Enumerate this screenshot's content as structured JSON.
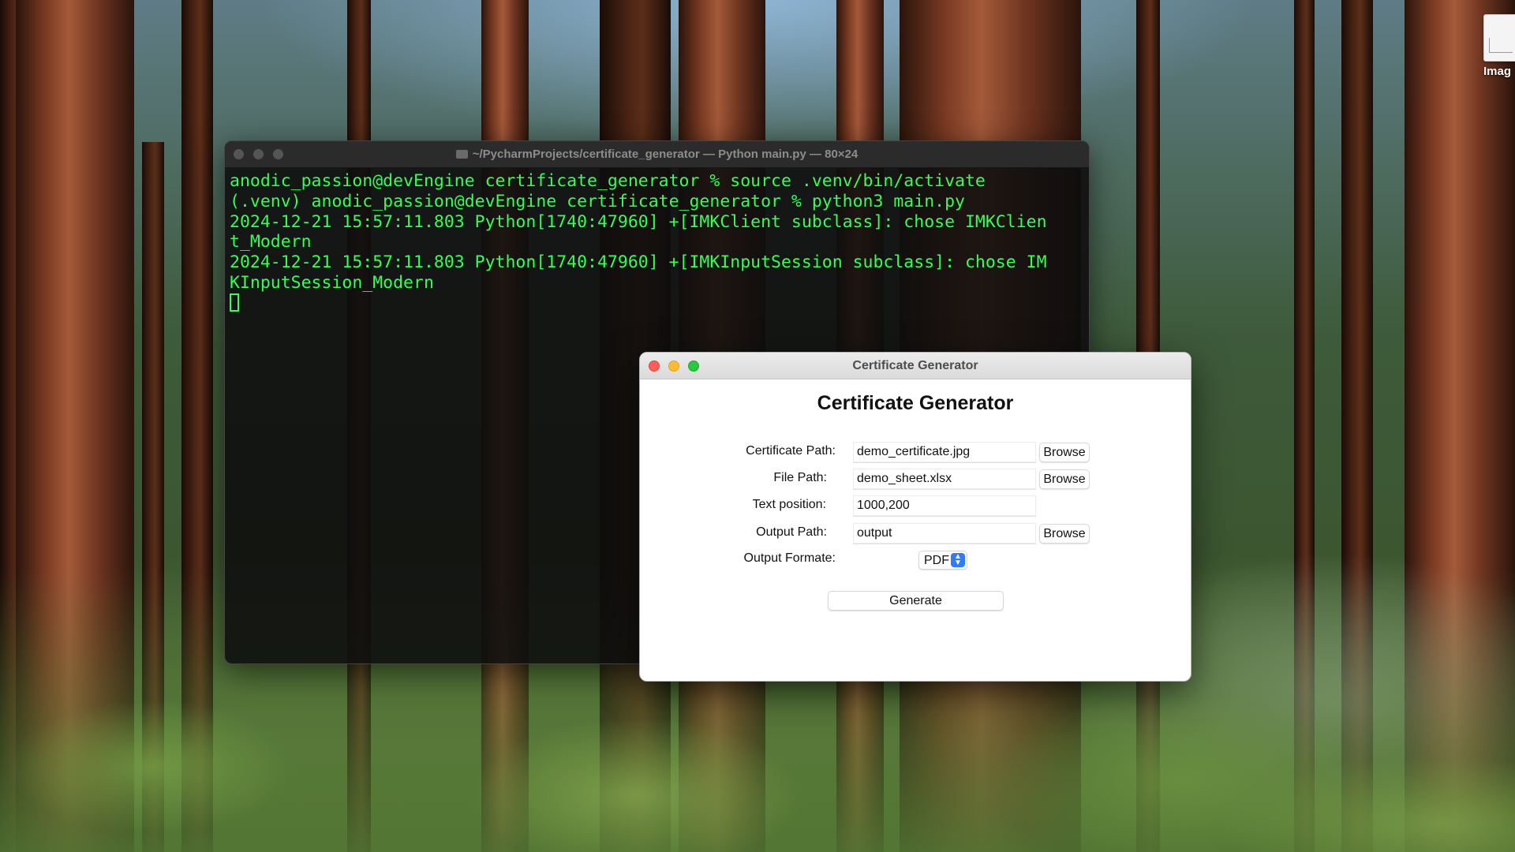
{
  "desktop": {
    "icon_label": "Imag"
  },
  "terminal": {
    "title": "~/PycharmProjects/certificate_generator — Python main.py — 80×24",
    "lines": [
      "anodic_passion@devEngine certificate_generator % source .venv/bin/activate",
      "(.venv) anodic_passion@devEngine certificate_generator % python3 main.py",
      "2024-12-21 15:57:11.803 Python[1740:47960] +[IMKClient subclass]: chose IMKClien",
      "t_Modern",
      "2024-12-21 15:57:11.803 Python[1740:47960] +[IMKInputSession subclass]: chose IM",
      "KInputSession_Modern"
    ],
    "text_color": "#33ff55"
  },
  "app": {
    "window_title": "Certificate Generator",
    "heading": "Certificate Generator",
    "certificate_path": {
      "label": "Certificate Path:",
      "value": "demo_certificate.jpg",
      "browse": "Browse"
    },
    "file_path": {
      "label": "File Path:",
      "value": "demo_sheet.xlsx",
      "browse": "Browse"
    },
    "text_position": {
      "label": "Text position:",
      "value": "1000,200"
    },
    "output_path": {
      "label": "Output Path:",
      "value": "output",
      "browse": "Browse"
    },
    "output_format": {
      "label": "Output Formate:",
      "selected": "PDF"
    },
    "generate_label": "Generate",
    "accent_color": "#2f7cf6"
  }
}
